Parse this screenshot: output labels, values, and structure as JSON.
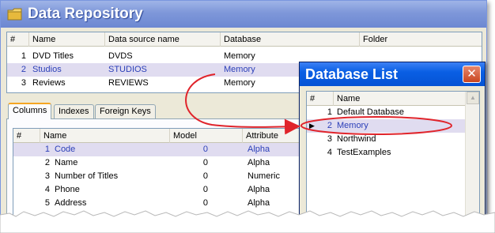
{
  "app": {
    "title": "Data Repository",
    "icon": "folder-icon"
  },
  "repository": {
    "columns": [
      "#",
      "Name",
      "Data source name",
      "Database",
      "Folder"
    ],
    "rows": [
      {
        "num": "1",
        "name": "DVD Titles",
        "source": "DVDS",
        "database": "Memory",
        "folder": "",
        "selected": false
      },
      {
        "num": "2",
        "name": "Studios",
        "source": "STUDIOS",
        "database": "Memory",
        "folder": "",
        "selected": true
      },
      {
        "num": "3",
        "name": "Reviews",
        "source": "REVIEWS",
        "database": "Memory",
        "folder": "",
        "selected": false
      }
    ]
  },
  "tabs": [
    "Columns",
    "Indexes",
    "Foreign Keys"
  ],
  "active_tab": "Columns",
  "columns_grid": {
    "columns": [
      "#",
      "Name",
      "Model",
      "Attribute"
    ],
    "rows": [
      {
        "num": "1",
        "name": "Code",
        "model": "0",
        "attribute": "Alpha",
        "selected": true
      },
      {
        "num": "2",
        "name": "Name",
        "model": "0",
        "attribute": "Alpha",
        "selected": false
      },
      {
        "num": "3",
        "name": "Number of Titles",
        "model": "0",
        "attribute": "Numeric",
        "selected": false
      },
      {
        "num": "4",
        "name": "Phone",
        "model": "0",
        "attribute": "Alpha",
        "selected": false
      },
      {
        "num": "5",
        "name": "Address",
        "model": "0",
        "attribute": "Alpha",
        "selected": false
      }
    ]
  },
  "database_list": {
    "title": "Database List",
    "close_glyph": "✕",
    "columns": [
      "#",
      "Name"
    ],
    "current_row_marker": "▶",
    "rows": [
      {
        "num": "1",
        "name": "Default Database",
        "selected": false
      },
      {
        "num": "2",
        "name": "Memory",
        "selected": true
      },
      {
        "num": "3",
        "name": "Northwind",
        "selected": false
      },
      {
        "num": "4",
        "name": "TestExamples",
        "selected": false
      }
    ],
    "scroll_up_glyph": "▲"
  },
  "colors": {
    "title_bar": "#7e97d9",
    "popup_title_bar": "#0a5fe4",
    "selection_bg": "#e0dcf0",
    "selection_text": "#2b3fb8",
    "annotation": "#e0242b",
    "tab_highlight": "#f5a623"
  }
}
